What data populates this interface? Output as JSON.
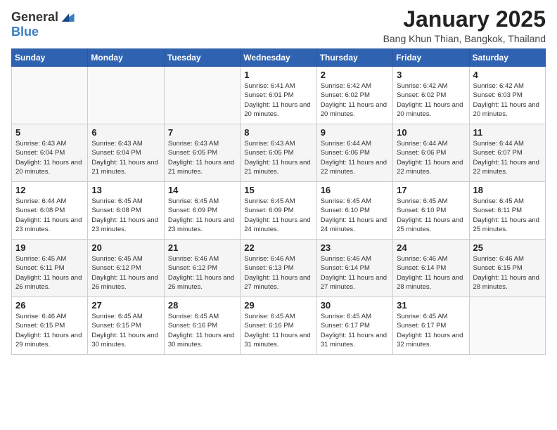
{
  "logo": {
    "general": "General",
    "blue": "Blue"
  },
  "title": "January 2025",
  "location": "Bang Khun Thian, Bangkok, Thailand",
  "weekdays": [
    "Sunday",
    "Monday",
    "Tuesday",
    "Wednesday",
    "Thursday",
    "Friday",
    "Saturday"
  ],
  "weeks": [
    [
      {
        "day": "",
        "info": ""
      },
      {
        "day": "",
        "info": ""
      },
      {
        "day": "",
        "info": ""
      },
      {
        "day": "1",
        "info": "Sunrise: 6:41 AM\nSunset: 6:01 PM\nDaylight: 11 hours and 20 minutes."
      },
      {
        "day": "2",
        "info": "Sunrise: 6:42 AM\nSunset: 6:02 PM\nDaylight: 11 hours and 20 minutes."
      },
      {
        "day": "3",
        "info": "Sunrise: 6:42 AM\nSunset: 6:02 PM\nDaylight: 11 hours and 20 minutes."
      },
      {
        "day": "4",
        "info": "Sunrise: 6:42 AM\nSunset: 6:03 PM\nDaylight: 11 hours and 20 minutes."
      }
    ],
    [
      {
        "day": "5",
        "info": "Sunrise: 6:43 AM\nSunset: 6:04 PM\nDaylight: 11 hours and 20 minutes."
      },
      {
        "day": "6",
        "info": "Sunrise: 6:43 AM\nSunset: 6:04 PM\nDaylight: 11 hours and 21 minutes."
      },
      {
        "day": "7",
        "info": "Sunrise: 6:43 AM\nSunset: 6:05 PM\nDaylight: 11 hours and 21 minutes."
      },
      {
        "day": "8",
        "info": "Sunrise: 6:43 AM\nSunset: 6:05 PM\nDaylight: 11 hours and 21 minutes."
      },
      {
        "day": "9",
        "info": "Sunrise: 6:44 AM\nSunset: 6:06 PM\nDaylight: 11 hours and 22 minutes."
      },
      {
        "day": "10",
        "info": "Sunrise: 6:44 AM\nSunset: 6:06 PM\nDaylight: 11 hours and 22 minutes."
      },
      {
        "day": "11",
        "info": "Sunrise: 6:44 AM\nSunset: 6:07 PM\nDaylight: 11 hours and 22 minutes."
      }
    ],
    [
      {
        "day": "12",
        "info": "Sunrise: 6:44 AM\nSunset: 6:08 PM\nDaylight: 11 hours and 23 minutes."
      },
      {
        "day": "13",
        "info": "Sunrise: 6:45 AM\nSunset: 6:08 PM\nDaylight: 11 hours and 23 minutes."
      },
      {
        "day": "14",
        "info": "Sunrise: 6:45 AM\nSunset: 6:09 PM\nDaylight: 11 hours and 23 minutes."
      },
      {
        "day": "15",
        "info": "Sunrise: 6:45 AM\nSunset: 6:09 PM\nDaylight: 11 hours and 24 minutes."
      },
      {
        "day": "16",
        "info": "Sunrise: 6:45 AM\nSunset: 6:10 PM\nDaylight: 11 hours and 24 minutes."
      },
      {
        "day": "17",
        "info": "Sunrise: 6:45 AM\nSunset: 6:10 PM\nDaylight: 11 hours and 25 minutes."
      },
      {
        "day": "18",
        "info": "Sunrise: 6:45 AM\nSunset: 6:11 PM\nDaylight: 11 hours and 25 minutes."
      }
    ],
    [
      {
        "day": "19",
        "info": "Sunrise: 6:45 AM\nSunset: 6:11 PM\nDaylight: 11 hours and 26 minutes."
      },
      {
        "day": "20",
        "info": "Sunrise: 6:45 AM\nSunset: 6:12 PM\nDaylight: 11 hours and 26 minutes."
      },
      {
        "day": "21",
        "info": "Sunrise: 6:46 AM\nSunset: 6:12 PM\nDaylight: 11 hours and 26 minutes."
      },
      {
        "day": "22",
        "info": "Sunrise: 6:46 AM\nSunset: 6:13 PM\nDaylight: 11 hours and 27 minutes."
      },
      {
        "day": "23",
        "info": "Sunrise: 6:46 AM\nSunset: 6:14 PM\nDaylight: 11 hours and 27 minutes."
      },
      {
        "day": "24",
        "info": "Sunrise: 6:46 AM\nSunset: 6:14 PM\nDaylight: 11 hours and 28 minutes."
      },
      {
        "day": "25",
        "info": "Sunrise: 6:46 AM\nSunset: 6:15 PM\nDaylight: 11 hours and 28 minutes."
      }
    ],
    [
      {
        "day": "26",
        "info": "Sunrise: 6:46 AM\nSunset: 6:15 PM\nDaylight: 11 hours and 29 minutes."
      },
      {
        "day": "27",
        "info": "Sunrise: 6:45 AM\nSunset: 6:15 PM\nDaylight: 11 hours and 30 minutes."
      },
      {
        "day": "28",
        "info": "Sunrise: 6:45 AM\nSunset: 6:16 PM\nDaylight: 11 hours and 30 minutes."
      },
      {
        "day": "29",
        "info": "Sunrise: 6:45 AM\nSunset: 6:16 PM\nDaylight: 11 hours and 31 minutes."
      },
      {
        "day": "30",
        "info": "Sunrise: 6:45 AM\nSunset: 6:17 PM\nDaylight: 11 hours and 31 minutes."
      },
      {
        "day": "31",
        "info": "Sunrise: 6:45 AM\nSunset: 6:17 PM\nDaylight: 11 hours and 32 minutes."
      },
      {
        "day": "",
        "info": ""
      }
    ]
  ]
}
